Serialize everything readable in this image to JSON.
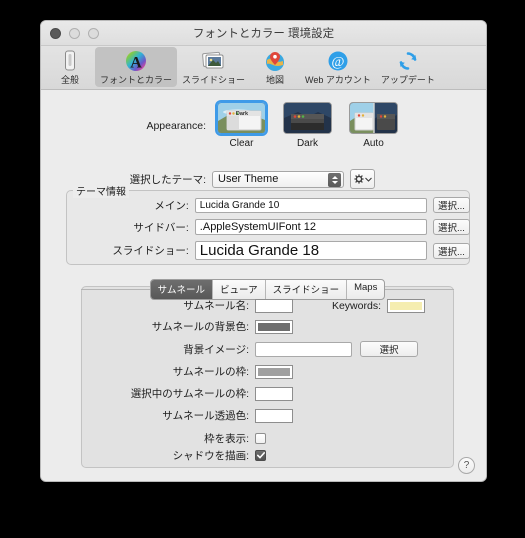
{
  "window": {
    "title": "フォントとカラー 環境設定",
    "traffic_lights": [
      "close",
      "minimize",
      "zoom"
    ]
  },
  "toolbar": {
    "items": [
      {
        "label": "全般",
        "icon": "battery-icon",
        "selected": false
      },
      {
        "label": "フォントとカラー",
        "icon": "font-color-icon",
        "selected": true
      },
      {
        "label": "スライドショー",
        "icon": "slideshow-icon",
        "selected": false
      },
      {
        "label": "地図",
        "icon": "map-pin-icon",
        "selected": false
      },
      {
        "label": "Web アカウント",
        "icon": "at-sign-icon",
        "selected": false
      },
      {
        "label": "アップデート",
        "icon": "refresh-icon",
        "selected": false
      }
    ]
  },
  "appearance": {
    "label": "Appearance:",
    "options": [
      {
        "name": "Clear",
        "selected": true
      },
      {
        "name": "Dark",
        "selected": false
      },
      {
        "name": "Auto",
        "selected": false
      }
    ]
  },
  "theme": {
    "label": "選択したテーマ:",
    "value": "User Theme",
    "action_icon": "gear-icon"
  },
  "theme_info": {
    "title": "テーマ情報",
    "rows": [
      {
        "label": "メイン:",
        "value": "Lucida Grande 10",
        "button": "選択...",
        "size": 10
      },
      {
        "label": "サイドバー:",
        "value": ".AppleSystemUIFont 12",
        "button": "選択...",
        "size": 11
      },
      {
        "label": "スライドショー:",
        "value": "Lucida Grande 18",
        "button": "選択...",
        "size": 15
      }
    ]
  },
  "tabs": [
    {
      "label": "サムネール",
      "selected": true
    },
    {
      "label": "ビューア",
      "selected": false
    },
    {
      "label": "スライドショー",
      "selected": false
    },
    {
      "label": "Maps",
      "selected": false
    }
  ],
  "thumbnail_panel": {
    "name_label": "サムネール名:",
    "name_color": "#ffffff",
    "keywords_label": "Keywords:",
    "keywords_color": "#f5edb0",
    "bg_color_label": "サムネールの背景色:",
    "bg_color": "#6e6e6e",
    "bg_image_label": "背景イメージ:",
    "bg_image_value": "",
    "bg_image_button": "選択",
    "frame_label": "サムネールの枠:",
    "frame_color": "#a0a0a0",
    "selected_frame_label": "選択中のサムネールの枠:",
    "selected_frame_color": "#ffffff",
    "transparent_label": "サムネール透過色:",
    "transparent_color": "#ffffff",
    "show_frame_label": "枠を表示:",
    "show_frame_checked": false,
    "draw_shadow_label": "シャドウを描画:",
    "draw_shadow_checked": true
  },
  "help_button": "?"
}
